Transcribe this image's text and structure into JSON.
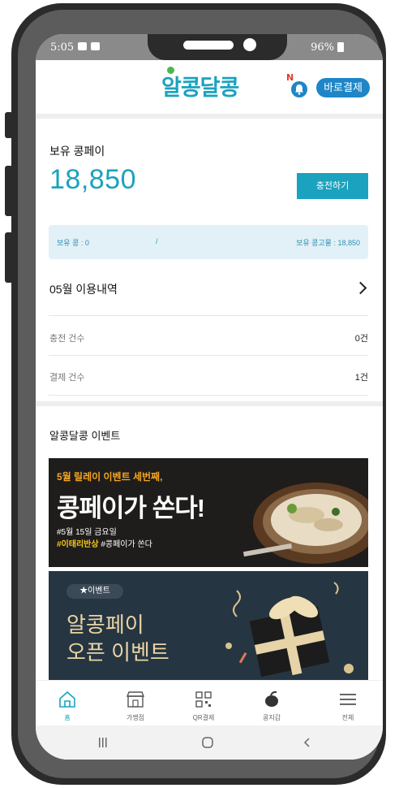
{
  "status_bar": {
    "time": "5:05",
    "battery": "96%"
  },
  "app": {
    "logo": "알콩달콩",
    "notification_badge": "N",
    "direct_pay_label": "바로결제"
  },
  "balance_section": {
    "title": "보유 콩페이",
    "amount": "18,850",
    "charge_button": "충전하기",
    "held_beans": "보유 콩 : 0",
    "divider": "/",
    "held_bean_amount": "보유 콩고물 : 18,850"
  },
  "usage_section": {
    "title": "05월 이용내역",
    "rows": [
      {
        "label": "충전 건수",
        "value": "0건"
      },
      {
        "label": "결제 건수",
        "value": "1건"
      }
    ]
  },
  "event_section": {
    "title": "알콩달콩 이벤트",
    "banners": [
      {
        "headline": "5월 릴레이 이벤트 세번째,",
        "title": "콩페이가 쏜다!",
        "date": "#5월 15일 금요일",
        "tag_highlight": "#이태리반상",
        "tag_rest": " #콩페이가 쏜다"
      },
      {
        "badge": "★이벤트",
        "line1": "알콩페이",
        "line2": "오픈 이벤트"
      }
    ]
  },
  "bottom_nav": [
    {
      "label": "홈",
      "icon": "home-icon",
      "active": true
    },
    {
      "label": "가맹점",
      "icon": "store-icon",
      "active": false
    },
    {
      "label": "QR결제",
      "icon": "qr-icon",
      "active": false
    },
    {
      "label": "콩지갑",
      "icon": "bean-wallet-icon",
      "active": false
    },
    {
      "label": "전체",
      "icon": "menu-icon",
      "active": false
    }
  ],
  "colors": {
    "accent": "#1aa2be",
    "brand_blue": "#1e86c7",
    "highlight_yellow": "#f5c51b",
    "banner_orange": "#f6a623"
  }
}
